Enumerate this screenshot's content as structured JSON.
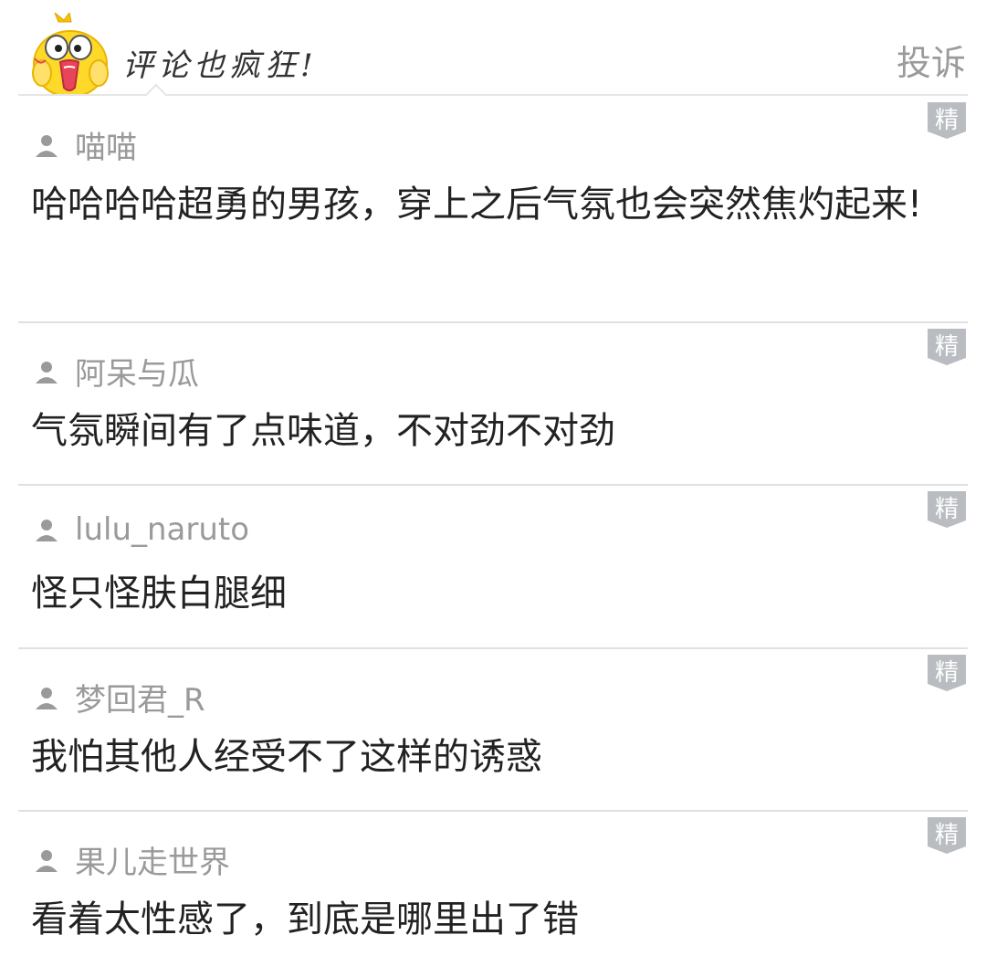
{
  "header": {
    "title": "评论也疯狂!",
    "report_label": "投诉"
  },
  "comments": [
    {
      "user": "喵喵",
      "badge": "精",
      "text": "哈哈哈哈超勇的男孩，穿上之后气氛也会突然焦灼起来!"
    },
    {
      "user": "阿呆与瓜",
      "badge": "精",
      "text": "气氛瞬间有了点味道，不对劲不对劲"
    },
    {
      "user": "lulu_naruto",
      "badge": "精",
      "text": "怪只怪肤白腿细"
    },
    {
      "user": "梦回君_R",
      "badge": "精",
      "text": "我怕其他人经受不了这样的诱惑"
    },
    {
      "user": "果儿走世界",
      "badge": "精",
      "text": "看着太性感了，到底是哪里出了错"
    }
  ],
  "colors": {
    "badge": "#b9bcc0",
    "username": "#9a9a9a",
    "text": "#222222",
    "divider": "#e0e0e0"
  }
}
